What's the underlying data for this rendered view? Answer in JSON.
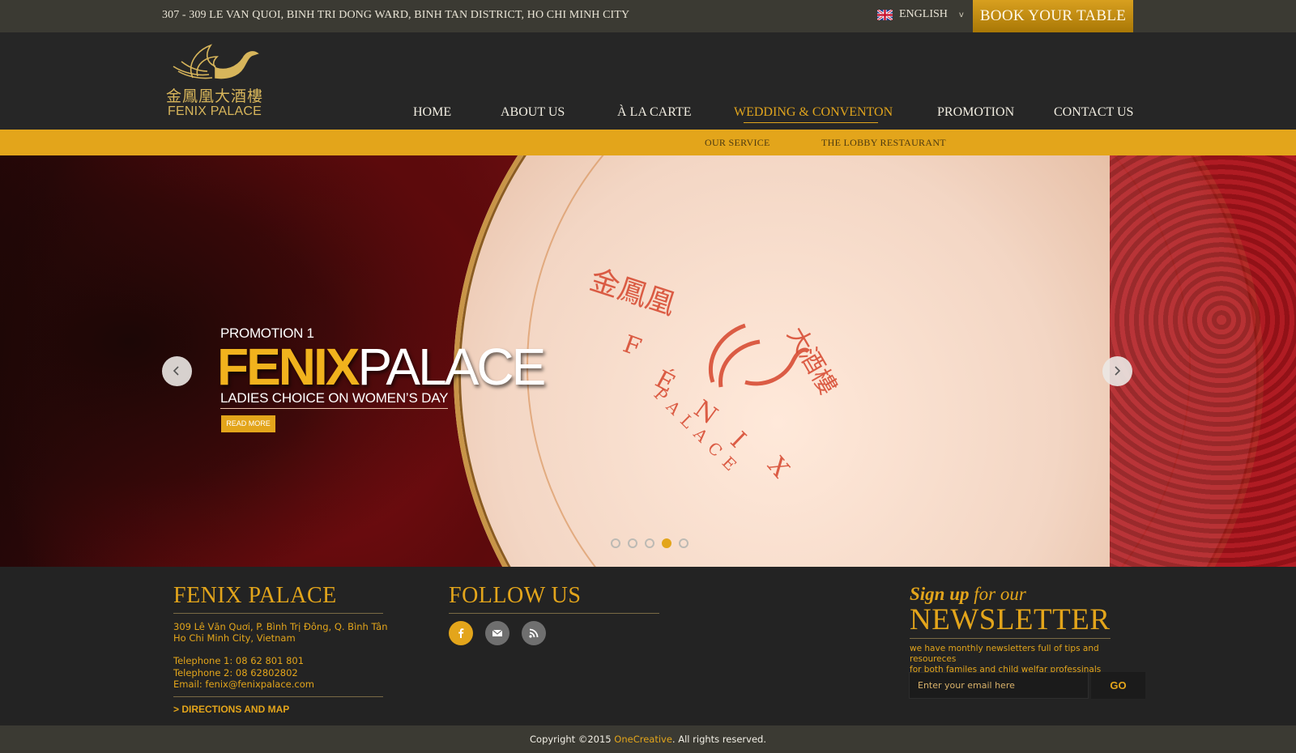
{
  "topbar": {
    "address": "307 - 309 LE VAN QUOI, BINH TRI DONG WARD, BINH TAN DISTRICT, HO CHI MINH CITY",
    "language": "ENGLISH",
    "book_button": "BOOK YOUR TABLE"
  },
  "logo": {
    "cn": "金鳳凰大酒樓",
    "en": "FENIX PALACE"
  },
  "nav": {
    "items": [
      "HOME",
      "ABOUT US",
      "À LA CARTE",
      "WEDDING & CONVENTON",
      "PROMOTION",
      "CONTACT US"
    ],
    "active": "WEDDING & CONVENTON"
  },
  "subnav": {
    "items": [
      "OUR SERVICE",
      "THE LOBBY RESTAURANT"
    ]
  },
  "hero": {
    "label": "PROMOTION 1",
    "title_gold": "FENIX",
    "title_white": "PALACE",
    "subtitle": "LADIES CHOICE ON WOMEN’S DAY",
    "read_more": "READ MORE",
    "slide_count": 5,
    "active_slide": 4,
    "plate_text": [
      "金鳳凰",
      "F",
      "É",
      "N",
      "I",
      "X",
      "PALACE",
      "大酒樓"
    ]
  },
  "footer": {
    "col1": {
      "title": "FENIX PALACE",
      "address_line1": "309 Lê Văn Quơi, P. Bình Trị Đông, Q. Bình Tân",
      "address_line2": "Ho Chi Minh City, Vietnam",
      "phone1": "Telephone 1: 08 62 801 801",
      "phone2": "Telephone 2: 08 62802802",
      "email": "Email: fenix@fenixpalace.com",
      "directions": "> DIRECTIONS AND MAP"
    },
    "col2": {
      "title": "FOLLOW US",
      "icons": [
        "facebook-icon",
        "email-icon",
        "rss-icon"
      ]
    },
    "newsletter": {
      "signup_bold": "Sign up",
      "signup_rest": " for our",
      "title": "NEWSLETTER",
      "description_line1": "we have monthly newsletters full of tips and resoureces",
      "description_line2": "for both familes and child welfar professinals",
      "input_placeholder": "Enter your email here",
      "go_button": "GO"
    },
    "copyright_prefix": "Copyright ©2015 ",
    "copyright_brand": "OneCreative",
    "copyright_suffix": ". All rights reserved."
  },
  "colors": {
    "accent": "#e3a51b",
    "topbar": "#3b3a33",
    "header": "#262626",
    "footer": "#232323"
  }
}
